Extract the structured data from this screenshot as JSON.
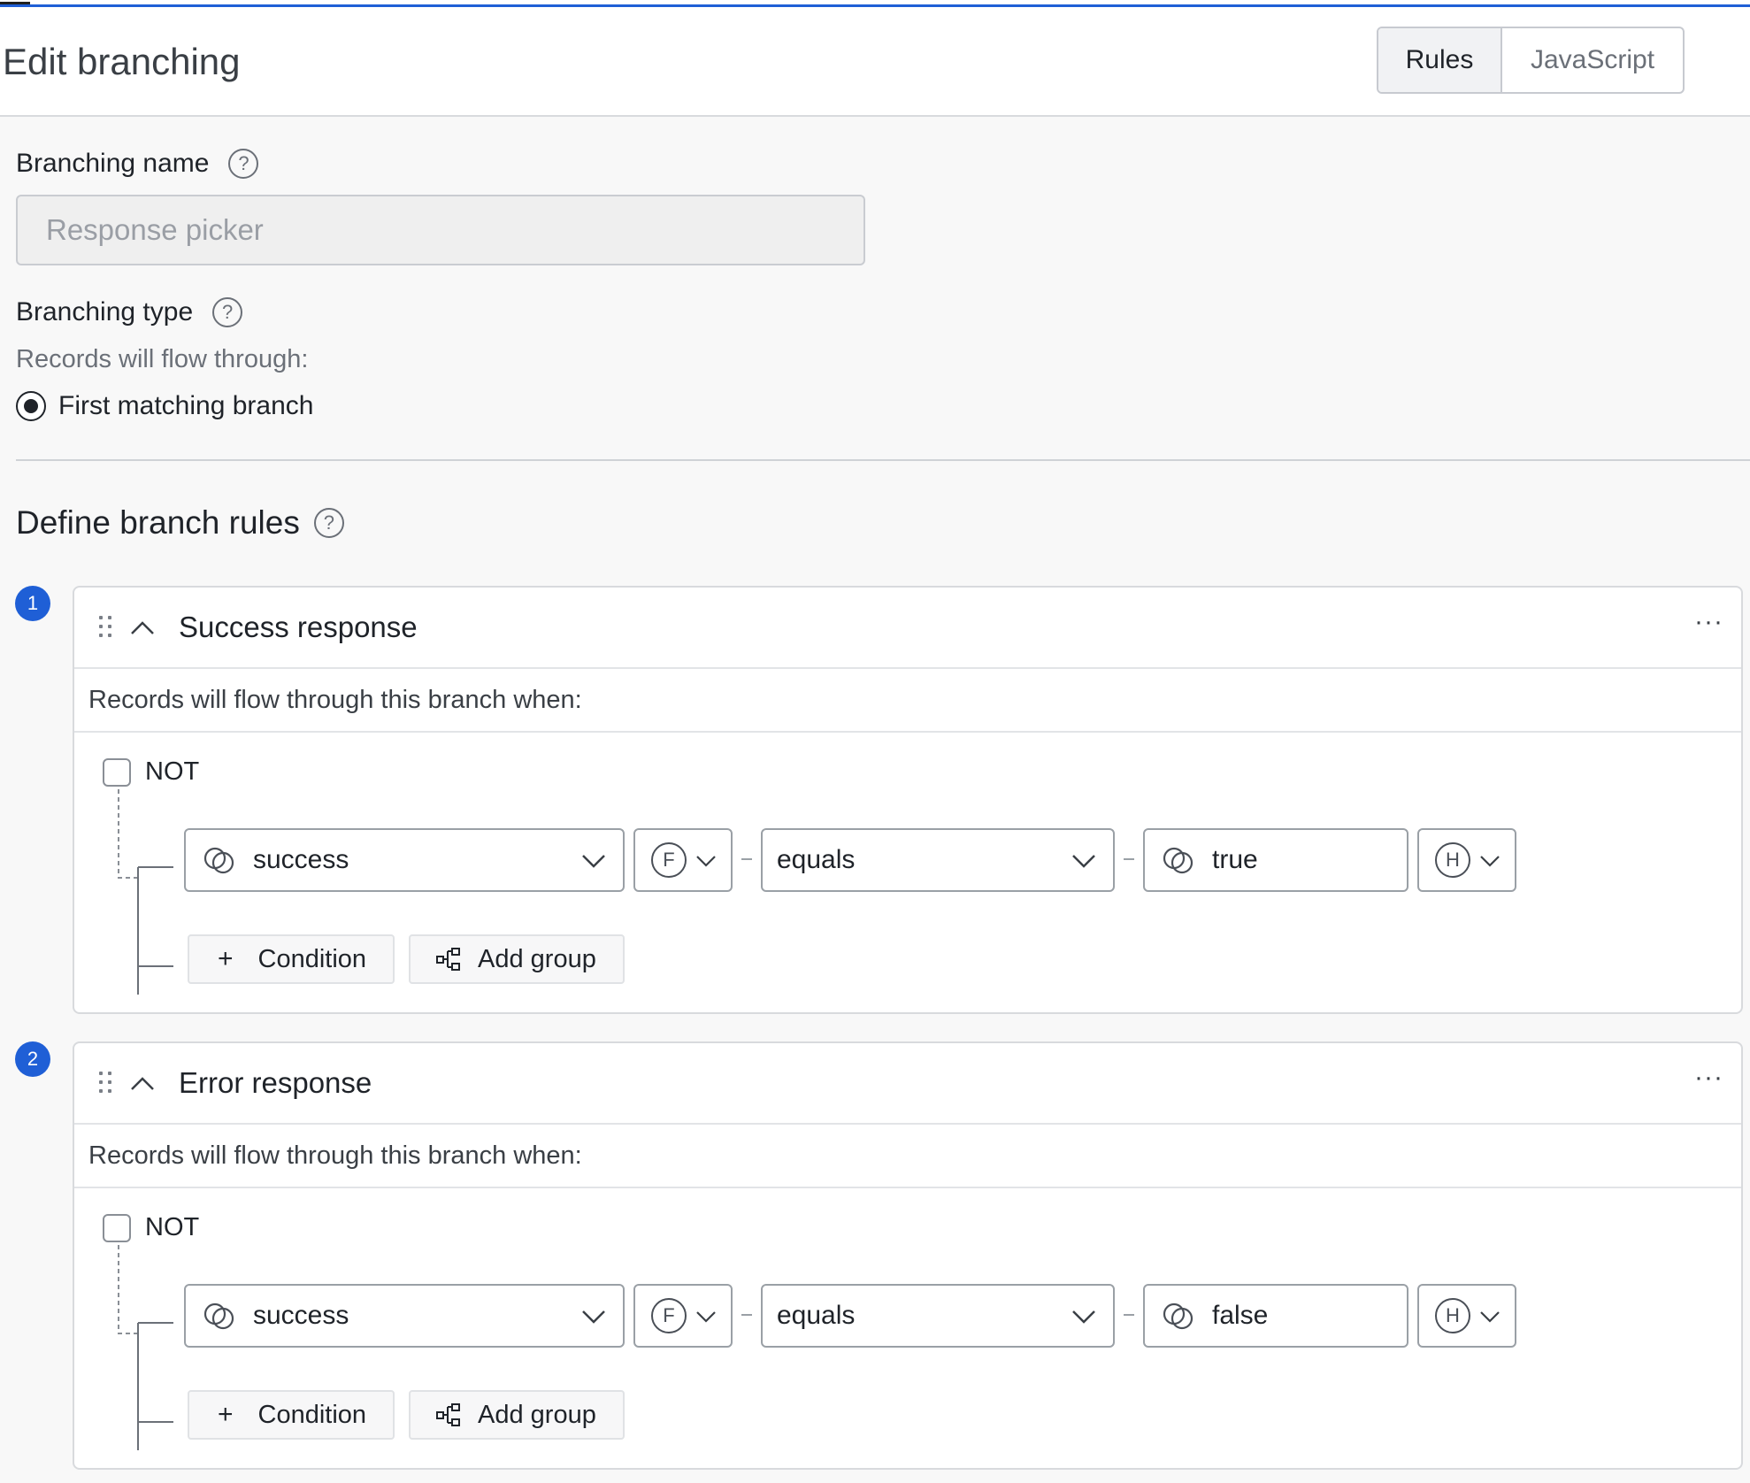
{
  "header": {
    "title": "Edit branching",
    "mode_tabs": [
      {
        "label": "Rules",
        "active": true
      },
      {
        "label": "JavaScript",
        "active": false
      }
    ]
  },
  "branching_name": {
    "label": "Branching name",
    "placeholder": "Response picker"
  },
  "branching_type": {
    "label": "Branching type",
    "description": "Records will flow through:",
    "option": "First matching branch",
    "selected": true
  },
  "rules_section": {
    "title": "Define branch rules"
  },
  "branches": [
    {
      "index": "1",
      "title": "Success response",
      "subtitle": "Records will flow through this branch when:",
      "not_label": "NOT",
      "condition": {
        "field": "success",
        "field_type": "F",
        "operator": "equals",
        "value": "true",
        "value_type": "H"
      },
      "add_condition_label": "Condition",
      "add_group_label": "Add group"
    },
    {
      "index": "2",
      "title": "Error response",
      "subtitle": "Records will flow through this branch when:",
      "not_label": "NOT",
      "condition": {
        "field": "success",
        "field_type": "F",
        "operator": "equals",
        "value": "false",
        "value_type": "H"
      },
      "add_condition_label": "Condition",
      "add_group_label": "Add group"
    }
  ],
  "icons": {
    "help": "question-circle-icon",
    "drag": "drag-handle-icon",
    "collapse": "chevron-up-icon",
    "more": "more-horizontal-icon",
    "field": "link-field-icon",
    "add": "plus-icon",
    "group": "group-tree-icon"
  },
  "colors": {
    "accent": "#1f5fd6"
  }
}
